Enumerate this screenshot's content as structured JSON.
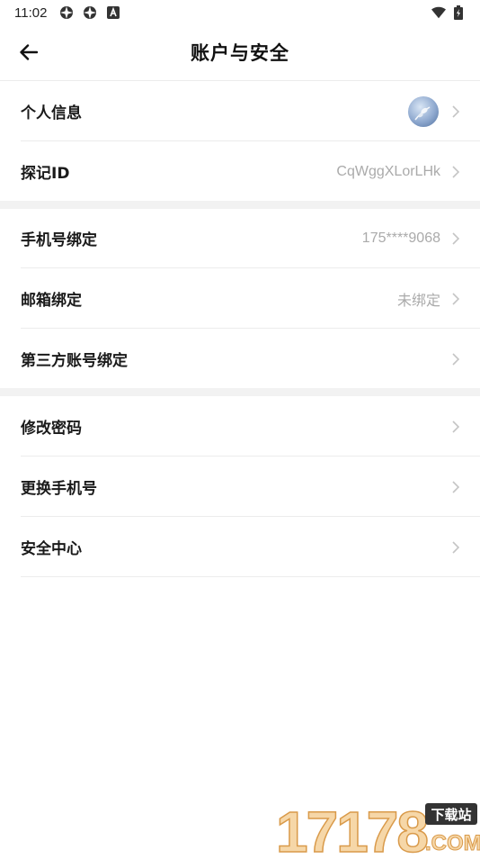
{
  "status_bar": {
    "time": "11:02"
  },
  "header": {
    "title": "账户与安全"
  },
  "groups": [
    {
      "rows": [
        {
          "label": "个人信息",
          "value": ""
        },
        {
          "label": "探记ID",
          "value": "CqWggXLorLHk"
        }
      ]
    },
    {
      "rows": [
        {
          "label": "手机号绑定",
          "value": "175****9068"
        },
        {
          "label": "邮箱绑定",
          "value": "未绑定"
        },
        {
          "label": "第三方账号绑定",
          "value": ""
        }
      ]
    },
    {
      "rows": [
        {
          "label": "修改密码",
          "value": ""
        },
        {
          "label": "更换手机号",
          "value": ""
        },
        {
          "label": "安全中心",
          "value": ""
        }
      ]
    }
  ],
  "watermark": {
    "number": "17178",
    "tag": "下载站",
    "domain": ".COM"
  },
  "colors": {
    "divider": "#ececec",
    "section_bg": "#f2f2f2",
    "secondary_text": "#aaaaaa"
  }
}
